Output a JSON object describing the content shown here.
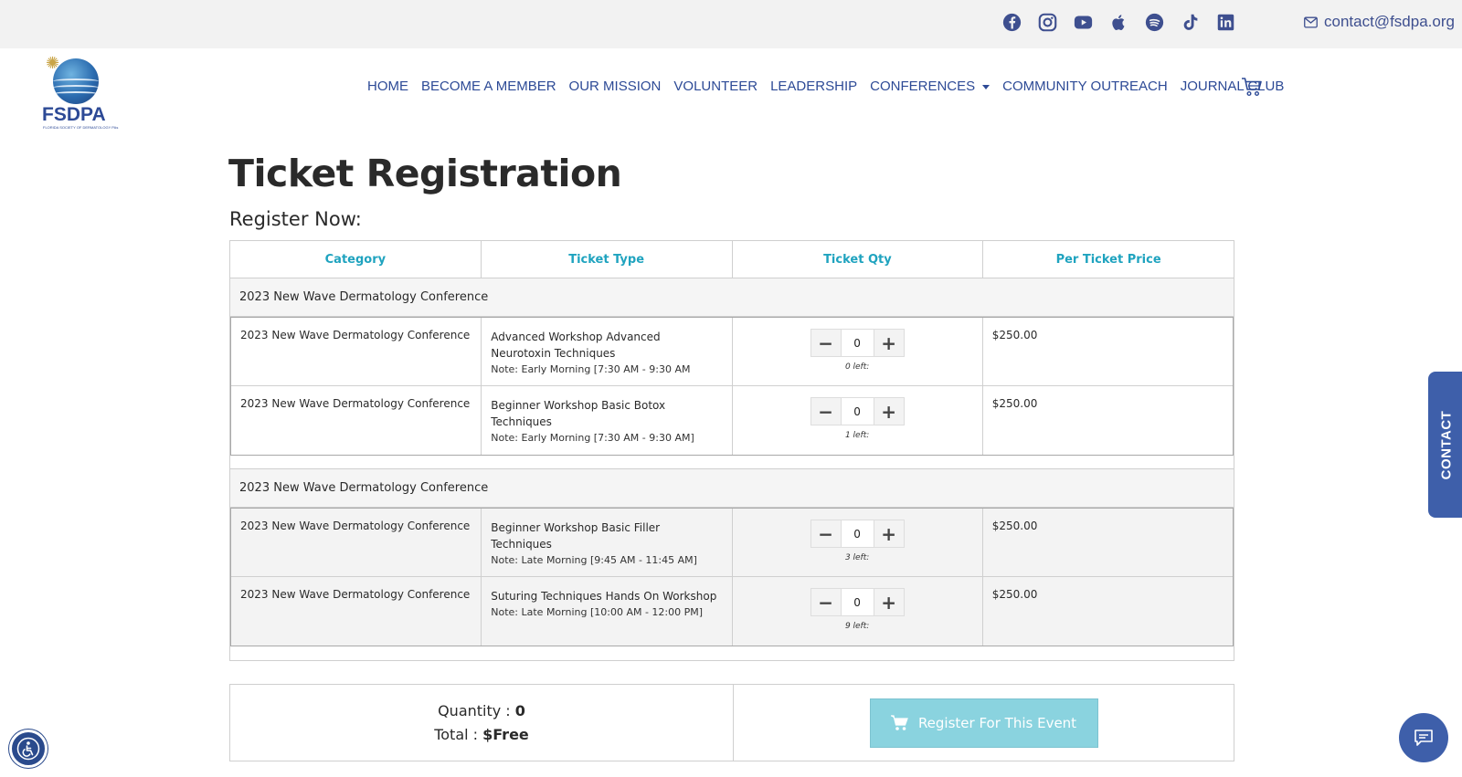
{
  "topbar": {
    "social_icons": [
      "facebook-icon",
      "instagram-icon",
      "youtube-icon",
      "apple-icon",
      "spotify-icon",
      "tiktok-icon",
      "linkedin-icon"
    ],
    "email": "contact@fsdpa.org"
  },
  "logo": {
    "text": "FSDPA",
    "subtitle": "FLORIDA SOCIETY OF DERMATOLOGY PAs"
  },
  "nav": {
    "items": [
      "HOME",
      "BECOME A MEMBER",
      "OUR MISSION",
      "VOLUNTEER",
      "LEADERSHIP",
      "CONFERENCES",
      "COMMUNITY OUTREACH",
      "JOURNAL CLUB"
    ]
  },
  "page": {
    "title": "Ticket Registration",
    "subtitle": "Register Now:"
  },
  "table": {
    "headers": [
      "Category",
      "Ticket Type",
      "Ticket Qty",
      "Per Ticket Price"
    ],
    "groups": [
      {
        "title": "2023 New Wave Dermatology Conference",
        "rows": [
          {
            "category": "2023 New Wave Dermatology Conference",
            "type": "Advanced Workshop Advanced Neurotoxin Techniques",
            "note": "Note: Early Morning [7:30 AM - 9:30 AM",
            "qty": "0",
            "left": "0 left:",
            "price": "$250.00"
          },
          {
            "category": "2023 New Wave Dermatology Conference",
            "type": "Beginner Workshop Basic Botox Techniques",
            "note": "Note: Early Morning [7:30 AM - 9:30 AM]",
            "qty": "0",
            "left": "1 left:",
            "price": "$250.00"
          }
        ]
      },
      {
        "title": "2023 New Wave Dermatology Conference",
        "rows": [
          {
            "category": "2023 New Wave Dermatology Conference",
            "type": "Beginner Workshop Basic Filler Techniques",
            "note": "Note: Late Morning [9:45 AM - 11:45 AM]",
            "qty": "0",
            "left": "3 left:",
            "price": "$250.00"
          },
          {
            "category": "2023 New Wave Dermatology Conference",
            "type": "Suturing Techniques Hands On Workshop",
            "note": "Note: Late Morning [10:00 AM - 12:00 PM]",
            "qty": "0",
            "left": "9 left:",
            "price": "$250.00"
          }
        ]
      }
    ]
  },
  "summary": {
    "quantity_label": "Quantity : ",
    "quantity_value": "0",
    "total_label": "Total : ",
    "total_value": "$Free",
    "register_label": "Register For This Event"
  },
  "contact_tab": "CONTACT",
  "colors": {
    "brand": "#2d4a96",
    "accent": "#1fa3bf",
    "button": "#8ad3df"
  }
}
